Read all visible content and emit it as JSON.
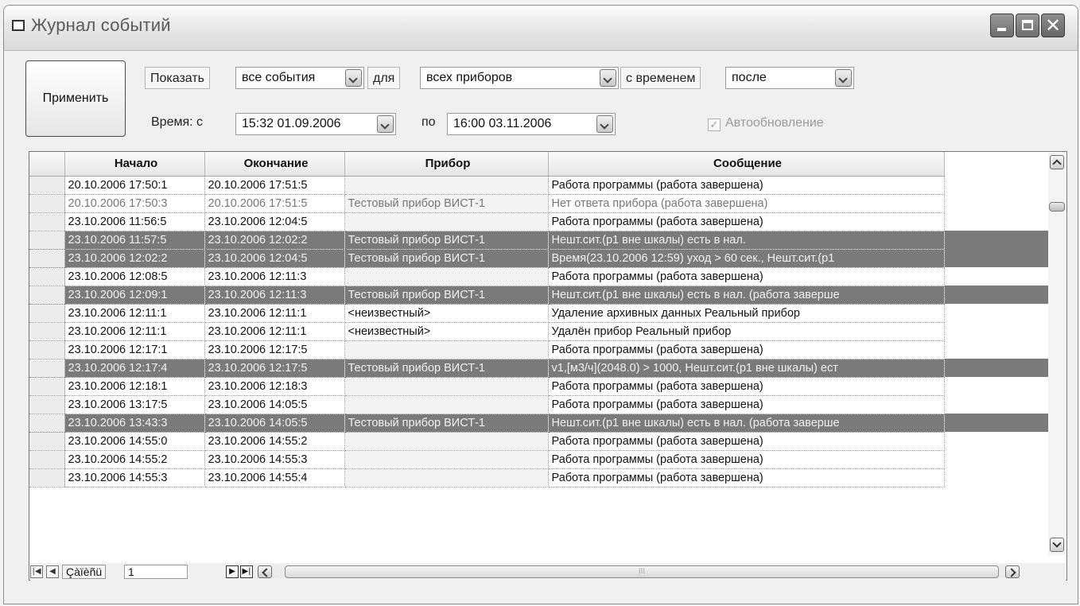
{
  "window": {
    "title": "Журнал событий"
  },
  "toolbar": {
    "apply_label": "Применить",
    "show_label": "Показать",
    "events_filter": "все события",
    "for_label": "для",
    "devices_filter": "всех приборов",
    "with_time_label": "с временем",
    "time_mode": "после",
    "time_label": "Время:  с",
    "time_from": "15:32  01.09.2006",
    "to_label": "по",
    "time_to": "16:00  03.11.2006",
    "autoupdate_label": "Автообновление",
    "autoupdate_checked": true
  },
  "grid": {
    "columns": [
      "Начало",
      "Окончание",
      "Прибор",
      "Сообщение"
    ],
    "rows": [
      {
        "start": "20.10.2006 17:50:1",
        "end": "20.10.2006 17:51:5",
        "device": "",
        "message": "Работа программы (работа завершена)",
        "style": "normal"
      },
      {
        "start": "20.10.2006 17:50:3",
        "end": "20.10.2006 17:51:5",
        "device": "Тестовый прибор ВИСТ-1",
        "message": "Нет ответа прибора (работа завершена)",
        "style": "grey"
      },
      {
        "start": "23.10.2006 11:56:5",
        "end": "23.10.2006 12:04:5",
        "device": "",
        "message": "Работа программы (работа завершена)",
        "style": "normal"
      },
      {
        "start": "23.10.2006 11:57:5",
        "end": "23.10.2006 12:02:2",
        "device": "Тестовый прибор ВИСТ-1",
        "message": "Нешт.сит.(p1 вне шкалы) есть в нал.",
        "style": "hl"
      },
      {
        "start": "23.10.2006 12:02:2",
        "end": "23.10.2006 12:04:5",
        "device": "Тестовый прибор ВИСТ-1",
        "message": "Время(23.10.2006  12:59) уход > 60 сек., Нешт.сит.(p1",
        "style": "hl"
      },
      {
        "start": "23.10.2006 12:08:5",
        "end": "23.10.2006 12:11:3",
        "device": "",
        "message": "Работа программы (работа завершена)",
        "style": "normal"
      },
      {
        "start": "23.10.2006 12:09:1",
        "end": "23.10.2006 12:11:3",
        "device": "Тестовый прибор ВИСТ-1",
        "message": "Нешт.сит.(p1 вне шкалы) есть в нал. (работа заверше",
        "style": "hl"
      },
      {
        "start": "23.10.2006 12:11:1",
        "end": "23.10.2006 12:11:1",
        "device": "<неизвестный>",
        "message": "Удаление архивных данных Реальный прибор",
        "style": "white"
      },
      {
        "start": "23.10.2006 12:11:1",
        "end": "23.10.2006 12:11:1",
        "device": "<неизвестный>",
        "message": "Удалён прибор Реальный прибор",
        "style": "white"
      },
      {
        "start": "23.10.2006 12:17:1",
        "end": "23.10.2006 12:17:5",
        "device": "",
        "message": "Работа программы (работа завершена)",
        "style": "normal"
      },
      {
        "start": "23.10.2006 12:17:4",
        "end": "23.10.2006 12:17:5",
        "device": "Тестовый прибор ВИСТ-1",
        "message": "v1,[м3/ч](2048.0) > 1000, Нешт.сит.(p1 вне шкалы) ест",
        "style": "hl"
      },
      {
        "start": "23.10.2006 12:18:1",
        "end": "23.10.2006 12:18:3",
        "device": "",
        "message": "Работа программы (работа завершена)",
        "style": "normal"
      },
      {
        "start": "23.10.2006 13:17:5",
        "end": "23.10.2006 14:05:5",
        "device": "",
        "message": "Работа программы (работа завершена)",
        "style": "normal"
      },
      {
        "start": "23.10.2006 13:43:3",
        "end": "23.10.2006 14:05:5",
        "device": "Тестовый прибор ВИСТ-1",
        "message": "Нешт.сит.(p1 вне шкалы) есть в нал. (работа заверше",
        "style": "hl"
      },
      {
        "start": "23.10.2006 14:55:0",
        "end": "23.10.2006 14:55:2",
        "device": "",
        "message": "Работа программы (работа завершена)",
        "style": "normal"
      },
      {
        "start": "23.10.2006 14:55:2",
        "end": "23.10.2006 14:55:3",
        "device": "",
        "message": "Работа программы (работа завершена)",
        "style": "normal"
      },
      {
        "start": "23.10.2006 14:55:3",
        "end": "23.10.2006 14:55:4",
        "device": "",
        "message": "Работа программы (работа завершена)",
        "style": "normal"
      }
    ]
  },
  "navigator": {
    "first_glyph": "|◀",
    "prev_glyph": "◀",
    "page_label": "Çàïèñü",
    "page_value": "1",
    "next_glyph": "▶",
    "last_glyph": "▶|",
    "hscroll_grip": "III"
  },
  "colors": {
    "highlight_row": "#7a7a7a",
    "window_bg": "#f0f0f0"
  }
}
